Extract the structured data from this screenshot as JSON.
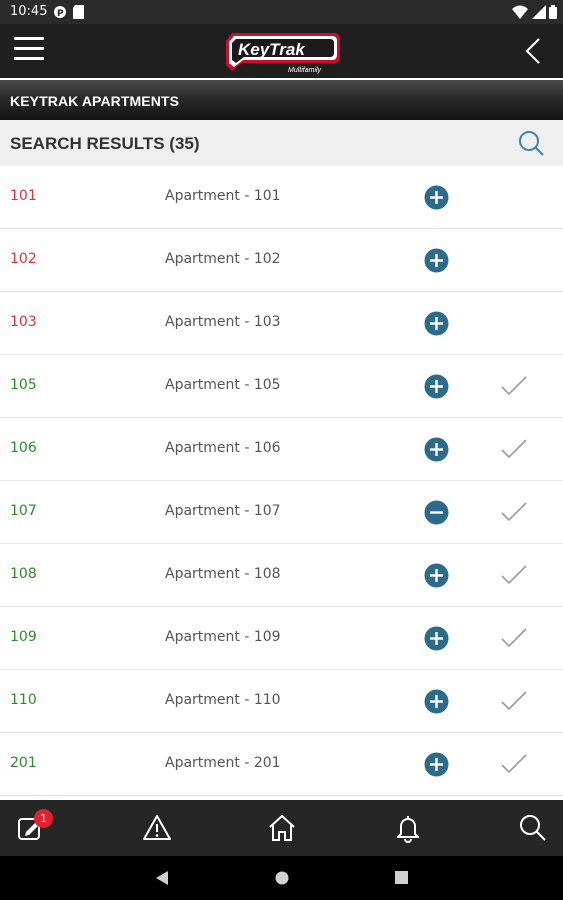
{
  "status_bar": {
    "time": "10:45",
    "icons": [
      "notification-icon",
      "sim-icon",
      "wifi-icon",
      "battery-icon"
    ]
  },
  "app_bar": {
    "logo_text": "KeyTrak",
    "logo_subtext": "Multifamily",
    "menu_icon": "hamburger-icon",
    "back_icon": "back-chevron-icon"
  },
  "property": {
    "title": "KEYTRAK APARTMENTS"
  },
  "results": {
    "title": "SEARCH RESULTS (35)",
    "search_icon": "search-icon"
  },
  "rows": [
    {
      "unit": "101",
      "name": "Apartment - 101",
      "status": "red",
      "action": "add",
      "checked": false
    },
    {
      "unit": "102",
      "name": "Apartment - 102",
      "status": "red",
      "action": "add",
      "checked": false
    },
    {
      "unit": "103",
      "name": "Apartment - 103",
      "status": "red",
      "action": "add",
      "checked": false
    },
    {
      "unit": "105",
      "name": "Apartment - 105",
      "status": "green",
      "action": "add",
      "checked": true
    },
    {
      "unit": "106",
      "name": "Apartment - 106",
      "status": "green",
      "action": "add",
      "checked": true
    },
    {
      "unit": "107",
      "name": "Apartment - 107",
      "status": "green",
      "action": "remove",
      "checked": true
    },
    {
      "unit": "108",
      "name": "Apartment - 108",
      "status": "green",
      "action": "add",
      "checked": true
    },
    {
      "unit": "109",
      "name": "Apartment - 109",
      "status": "green",
      "action": "add",
      "checked": true
    },
    {
      "unit": "110",
      "name": "Apartment - 110",
      "status": "green",
      "action": "add",
      "checked": true
    },
    {
      "unit": "201",
      "name": "Apartment - 201",
      "status": "green",
      "action": "add",
      "checked": true
    }
  ],
  "bottom_nav": {
    "items": [
      "edit-notes-icon",
      "alert-triangle-icon",
      "home-icon",
      "bell-icon",
      "search-icon"
    ],
    "badge": "1"
  },
  "system_nav": [
    "back-triangle-icon",
    "home-circle-icon",
    "recents-square-icon"
  ],
  "colors": {
    "accent_blue": "#2d6b8c",
    "status_red": "#e0323c",
    "status_green": "#2e8b2e",
    "badge_red": "#e0212f"
  }
}
